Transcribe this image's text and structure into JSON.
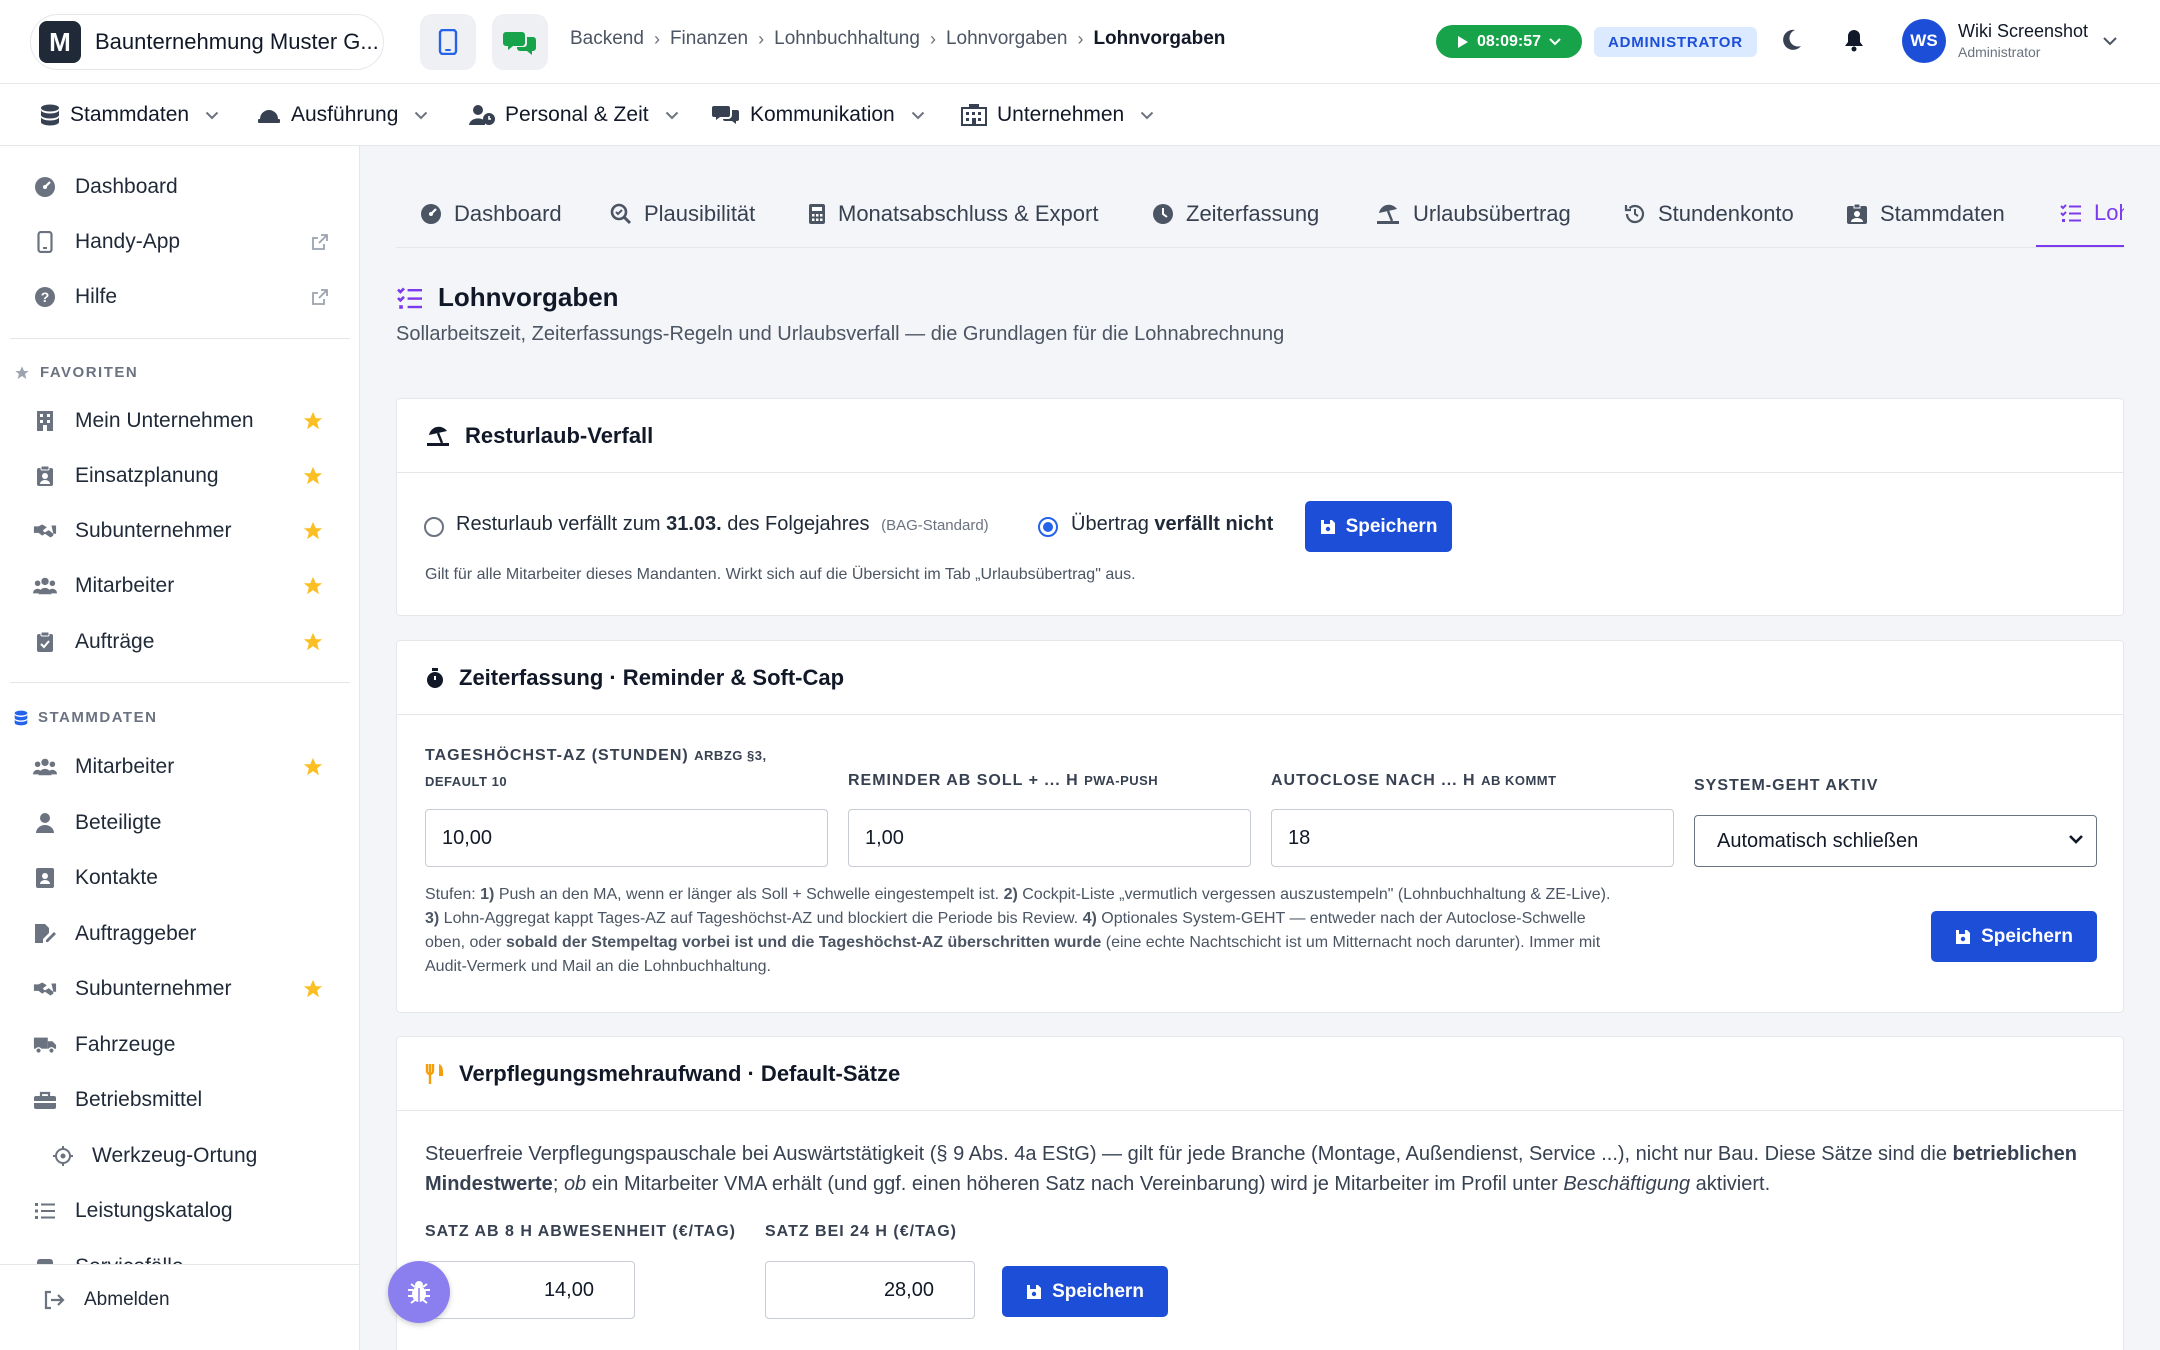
{
  "topbar": {
    "company_name": "Baunternehmung Muster G...",
    "logo_letter": "M",
    "breadcrumb": [
      "Backend",
      "Finanzen",
      "Lohnbuchhaltung",
      "Lohnvorgaben",
      "Lohnvorgaben"
    ],
    "timer": "08:09:57",
    "role_badge": "ADMINISTRATOR",
    "user_initials": "WS",
    "user_name": "Wiki Screenshot",
    "user_role": "Administrator"
  },
  "menubar": {
    "items": [
      "Stammdaten",
      "Ausführung",
      "Personal & Zeit",
      "Kommunikation",
      "Unternehmen"
    ]
  },
  "sidebar": {
    "top_items": [
      "Dashboard",
      "Handy-App",
      "Hilfe"
    ],
    "favorites_heading": "FAVORITEN",
    "favorites": [
      "Mein Unternehmen",
      "Einsatzplanung",
      "Subunternehmer",
      "Mitarbeiter",
      "Aufträge"
    ],
    "stammdaten_heading": "STAMMDATEN",
    "stammdaten": [
      "Mitarbeiter",
      "Beteiligte",
      "Kontakte",
      "Auftraggeber",
      "Subunternehmer",
      "Fahrzeuge",
      "Betriebsmittel",
      "Werkzeug-Ortung",
      "Leistungskatalog",
      "Servicefälle"
    ],
    "logout": "Abmelden"
  },
  "tabs": [
    "Dashboard",
    "Plausibilität",
    "Monatsabschluss & Export",
    "Zeiterfassung",
    "Urlaubsübertrag",
    "Stundenkonto",
    "Stammdaten",
    "Lohnvorgaben"
  ],
  "page": {
    "title": "Lohnvorgaben",
    "subtitle": "Sollarbeitszeit, Zeiterfassungs-Regeln und Urlaubsverfall — die Grundlagen für die Lohnabrechnung"
  },
  "resturlaub": {
    "title": "Resturlaub-Verfall",
    "option1_pre": "Resturlaub verfällt zum ",
    "option1_date": "31.03.",
    "option1_post": " des Folgejahres",
    "option1_hint": "(BAG-Standard)",
    "option2_pre": "Übertrag ",
    "option2_bold": "verfällt nicht",
    "selected": "option2",
    "save": "Speichern",
    "note": "Gilt für alle Mitarbeiter dieses Mandanten. Wirkt sich auf die Übersicht im Tab „Urlaubsübertrag\" aus."
  },
  "zeiterfassung": {
    "title": "Zeiterfassung · Reminder & Soft-Cap",
    "f1_label": "TAGESHÖCHST-AZ (STUNDEN)",
    "f1_hint": "ARBZG §3,",
    "f1_hint2": "DEFAULT 10",
    "f1_value": "10,00",
    "f2_label": "REMINDER AB SOLL + ... H",
    "f2_hint": "PWA-PUSH",
    "f2_value": "1,00",
    "f3_label": "AUTOCLOSE NACH ... H",
    "f3_hint": "AB KOMMT",
    "f3_value": "18",
    "f4_label": "SYSTEM-GEHT AKTIV",
    "f4_value": "Automatisch schließen",
    "note": {
      "s1": "Stufen: ",
      "n1": "1)",
      "t1": " Push an den MA, wenn er länger als Soll + Schwelle eingestempelt ist. ",
      "n2": "2)",
      "t2": " Cockpit-Liste „vermutlich vergessen auszustempeln\" (Lohnbuchhaltung & ZE-Live). ",
      "n3": "3)",
      "t3": " Lohn-Aggregat kappt Tages-AZ auf Tageshöchst-AZ und blockiert die Periode bis Review. ",
      "n4": "4)",
      "t4": " Optionales System-GEHT — entweder nach der Autoclose-Schwelle oben, oder ",
      "b1": "sobald der Stempeltag vorbei ist und die Tageshöchst-AZ überschritten wurde",
      "t5": " (eine echte Nachtschicht ist um Mitternacht noch darunter). Immer mit Audit-Vermerk und Mail an die Lohnbuchhaltung."
    },
    "save": "Speichern"
  },
  "verpflegung": {
    "title": "Verpflegungsmehraufwand · Default-Sätze",
    "desc1": "Steuerfreie Verpflegungspauschale bei Auswärtstätigkeit (§ 9 Abs. 4a EStG) — gilt für jede Branche (Montage, Außendienst, Service ...), nicht nur Bau. Diese Sätze sind die ",
    "desc_b": "betrieblichen Mindestwerte",
    "desc2": "; ",
    "desc_i1": "ob",
    "desc3": " ein Mitarbeiter VMA erhält (und ggf. einen höheren Satz nach Vereinbarung) wird je Mitarbeiter im Profil unter ",
    "desc_i2": "Beschäftigung",
    "desc4": " aktiviert.",
    "f1_label": "SATZ AB 8 H ABWESENHEIT (€/TAG)",
    "f1_value": "14,00",
    "f2_label": "SATZ BEI 24 H (€/TAG)",
    "f2_value": "28,00",
    "save": "Speichern"
  }
}
